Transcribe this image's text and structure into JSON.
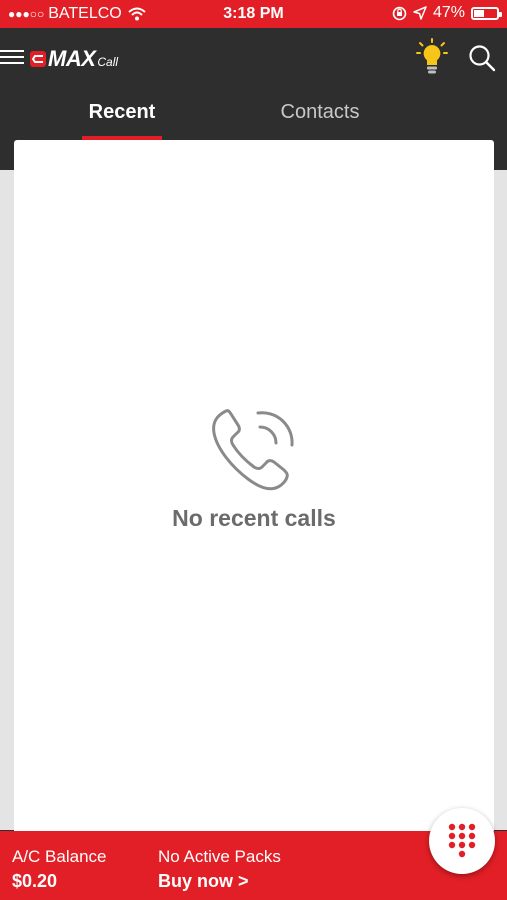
{
  "status_bar": {
    "signal": "●●●○○",
    "carrier": "BATELCO",
    "time": "3:18 PM",
    "battery_percent": "47%",
    "battery_level": 0.47
  },
  "header": {
    "logo_text": "MAX",
    "logo_sub": "Call",
    "icons": {
      "menu": "menu-icon",
      "bulb": "bulb-icon",
      "search": "search-icon"
    }
  },
  "tabs": [
    {
      "label": "Recent",
      "active": true
    },
    {
      "label": "Contacts",
      "active": false
    }
  ],
  "main": {
    "empty_message": "No recent calls",
    "icon": "phone-call-icon"
  },
  "footer": {
    "balance_label": "A/C Balance",
    "balance_value": "$0.20",
    "packs_label": "No Active Packs",
    "buy_label": "Buy now >"
  },
  "colors": {
    "brand_red": "#e21f26",
    "header_dark": "#2e2e2e",
    "bulb_yellow": "#f5c518"
  }
}
